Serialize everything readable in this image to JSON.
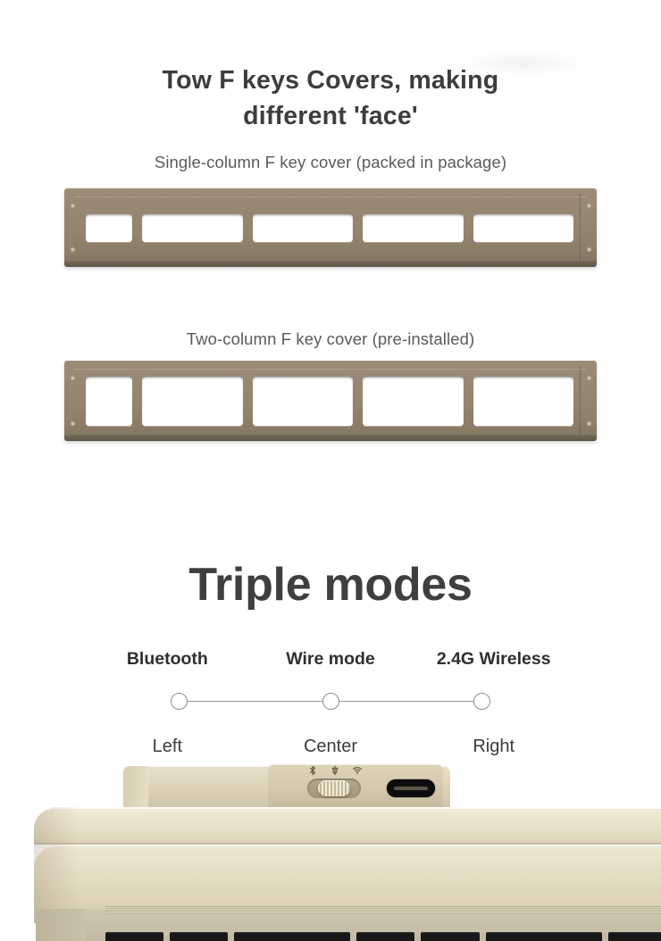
{
  "section_covers": {
    "heading_line1": "Tow F keys Covers, making",
    "heading_line2": "different 'face'",
    "caption_single": "Single-column F key cover (packed in package)",
    "caption_double": "Two-column F key cover (pre-installed)",
    "plate_color": "#948571",
    "cutout_color": "#ffffff",
    "plate_single_name": "single-column-f-key-cover",
    "plate_double_name": "two-column-f-key-cover"
  },
  "section_modes": {
    "heading": "Triple modes",
    "modes": [
      {
        "label": "Bluetooth",
        "position": "Left",
        "icon": "bluetooth-icon"
      },
      {
        "label": "Wire mode",
        "position": "Center",
        "icon": "wired-icon"
      },
      {
        "label": "2.4G Wireless",
        "position": "Right",
        "icon": "wifi-icon"
      }
    ],
    "heading_color": "#3f3f3f",
    "label_color": "#2f2f2f",
    "position_color": "#3b3b3b",
    "node_outline_color": "#8e8e8e"
  },
  "keyboard_photo": {
    "case_color": "#e9e0c9",
    "rear_module_color": "#ded3ba",
    "switch": {
      "type": "three-position-slider",
      "knob_position": "center",
      "icons": [
        "bluetooth-icon",
        "wired-icon",
        "wifi-icon"
      ]
    },
    "port": {
      "type": "usb-c",
      "color": "#0d0d0d"
    },
    "keycap_color": "#17181a"
  }
}
